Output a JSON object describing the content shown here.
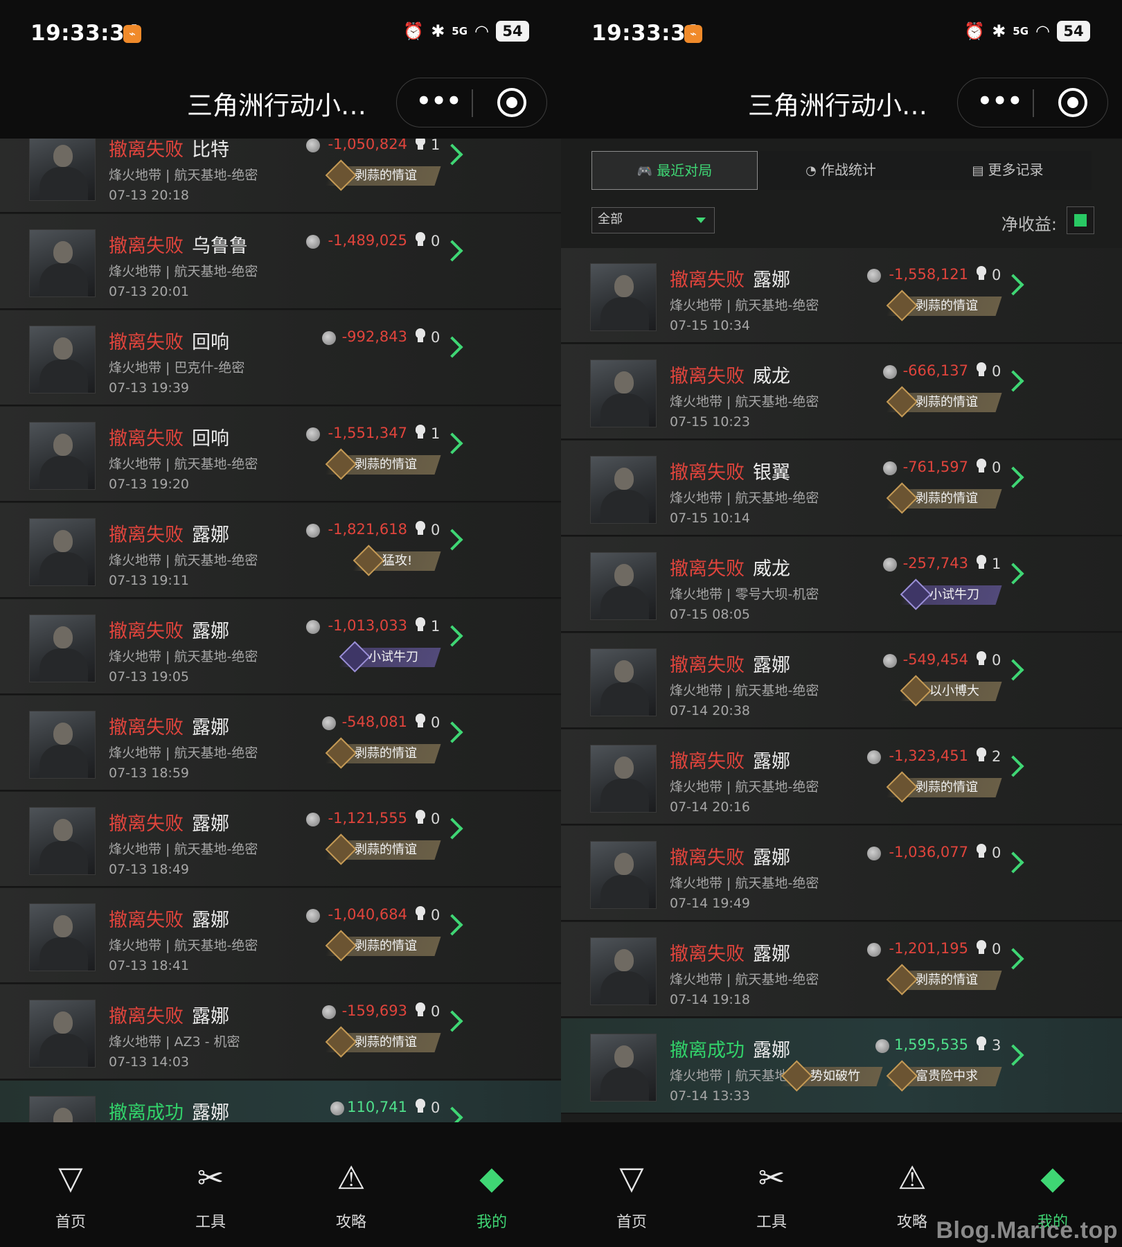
{
  "left": {
    "status_time": "19:33:34",
    "battery": "54",
    "signal": "5G",
    "title": "三角洲行动小…",
    "matches": [
      {
        "result": "撤离失败",
        "operator": "比特",
        "map": "烽火地带 | 航天基地-绝密",
        "time": "07-13 20:18",
        "value": "-1,050,824",
        "kills": "1",
        "badges": [
          {
            "label": "剥蒜的情谊",
            "tone": "gold"
          }
        ]
      },
      {
        "result": "撤离失败",
        "operator": "乌鲁鲁",
        "map": "烽火地带 | 航天基地-绝密",
        "time": "07-13 20:01",
        "value": "-1,489,025",
        "kills": "0",
        "badges": []
      },
      {
        "result": "撤离失败",
        "operator": "回响",
        "map": "烽火地带 | 巴克什-绝密",
        "time": "07-13 19:39",
        "value": "-992,843",
        "kills": "0",
        "badges": []
      },
      {
        "result": "撤离失败",
        "operator": "回响",
        "map": "烽火地带 | 航天基地-绝密",
        "time": "07-13 19:20",
        "value": "-1,551,347",
        "kills": "1",
        "badges": [
          {
            "label": "剥蒜的情谊",
            "tone": "gold"
          }
        ]
      },
      {
        "result": "撤离失败",
        "operator": "露娜",
        "map": "烽火地带 | 航天基地-绝密",
        "time": "07-13 19:11",
        "value": "-1,821,618",
        "kills": "0",
        "badges": [
          {
            "label": "猛攻!",
            "tone": "gold"
          }
        ]
      },
      {
        "result": "撤离失败",
        "operator": "露娜",
        "map": "烽火地带 | 航天基地-绝密",
        "time": "07-13 19:05",
        "value": "-1,013,033",
        "kills": "1",
        "badges": [
          {
            "label": "小试牛刀",
            "tone": "purple"
          }
        ]
      },
      {
        "result": "撤离失败",
        "operator": "露娜",
        "map": "烽火地带 | 航天基地-绝密",
        "time": "07-13 18:59",
        "value": "-548,081",
        "kills": "0",
        "badges": [
          {
            "label": "剥蒜的情谊",
            "tone": "gold"
          }
        ]
      },
      {
        "result": "撤离失败",
        "operator": "露娜",
        "map": "烽火地带 | 航天基地-绝密",
        "time": "07-13 18:49",
        "value": "-1,121,555",
        "kills": "0",
        "badges": [
          {
            "label": "剥蒜的情谊",
            "tone": "gold"
          }
        ]
      },
      {
        "result": "撤离失败",
        "operator": "露娜",
        "map": "烽火地带 | 航天基地-绝密",
        "time": "07-13 18:41",
        "value": "-1,040,684",
        "kills": "0",
        "badges": [
          {
            "label": "剥蒜的情谊",
            "tone": "gold"
          }
        ]
      },
      {
        "result": "撤离失败",
        "operator": "露娜",
        "map": "烽火地带 | AZ3 - 机密",
        "time": "07-13 14:03",
        "value": "-159,693",
        "kills": "0",
        "badges": [
          {
            "label": "剥蒜的情谊",
            "tone": "gold"
          }
        ]
      },
      {
        "result": "撤离成功",
        "operator": "露娜",
        "map": "",
        "time": "",
        "value": "110,741",
        "kills": "0",
        "badges": [],
        "success": true
      }
    ],
    "nav": [
      {
        "label": "首页",
        "icon": "home-icon"
      },
      {
        "label": "工具",
        "icon": "tools-icon"
      },
      {
        "label": "攻略",
        "icon": "guide-icon"
      },
      {
        "label": "我的",
        "icon": "profile-icon",
        "active": true
      }
    ]
  },
  "right": {
    "status_time": "19:33:31",
    "battery": "54",
    "signal": "5G",
    "title": "三角洲行动小…",
    "tabs": [
      {
        "label": "最近对局",
        "icon": "gamepad-icon",
        "active": true
      },
      {
        "label": "作战统计",
        "icon": "pie-chart-icon"
      },
      {
        "label": "更多记录",
        "icon": "document-icon"
      }
    ],
    "filter_value": "全部",
    "net_label": "净收益:",
    "matches": [
      {
        "result": "撤离失败",
        "operator": "露娜",
        "map": "烽火地带 | 航天基地-绝密",
        "time": "07-15 10:34",
        "value": "-1,558,121",
        "kills": "0",
        "badges": [
          {
            "label": "剥蒜的情谊",
            "tone": "gold"
          }
        ]
      },
      {
        "result": "撤离失败",
        "operator": "威龙",
        "map": "烽火地带 | 航天基地-绝密",
        "time": "07-15 10:23",
        "value": "-666,137",
        "kills": "0",
        "badges": [
          {
            "label": "剥蒜的情谊",
            "tone": "gold"
          }
        ]
      },
      {
        "result": "撤离失败",
        "operator": "银翼",
        "map": "烽火地带 | 航天基地-绝密",
        "time": "07-15 10:14",
        "value": "-761,597",
        "kills": "0",
        "badges": [
          {
            "label": "剥蒜的情谊",
            "tone": "gold"
          }
        ]
      },
      {
        "result": "撤离失败",
        "operator": "威龙",
        "map": "烽火地带 | 零号大坝-机密",
        "time": "07-15 08:05",
        "value": "-257,743",
        "kills": "1",
        "badges": [
          {
            "label": "小试牛刀",
            "tone": "purple"
          }
        ]
      },
      {
        "result": "撤离失败",
        "operator": "露娜",
        "map": "烽火地带 | 航天基地-绝密",
        "time": "07-14 20:38",
        "value": "-549,454",
        "kills": "0",
        "badges": [
          {
            "label": "以小博大",
            "tone": "gold"
          }
        ]
      },
      {
        "result": "撤离失败",
        "operator": "露娜",
        "map": "烽火地带 | 航天基地-绝密",
        "time": "07-14 20:16",
        "value": "-1,323,451",
        "kills": "2",
        "badges": [
          {
            "label": "剥蒜的情谊",
            "tone": "gold"
          }
        ]
      },
      {
        "result": "撤离失败",
        "operator": "露娜",
        "map": "烽火地带 | 航天基地-绝密",
        "time": "07-14 19:49",
        "value": "-1,036,077",
        "kills": "0",
        "badges": []
      },
      {
        "result": "撤离失败",
        "operator": "露娜",
        "map": "烽火地带 | 航天基地-绝密",
        "time": "07-14 19:18",
        "value": "-1,201,195",
        "kills": "0",
        "badges": [
          {
            "label": "剥蒜的情谊",
            "tone": "gold"
          }
        ]
      },
      {
        "result": "撤离成功",
        "operator": "露娜",
        "map": "烽火地带 | 航天基地-绝密",
        "time": "07-14 13:33",
        "value": "1,595,535",
        "kills": "3",
        "badges": [
          {
            "label": "势如破竹",
            "tone": "gold"
          },
          {
            "label": "富贵险中求",
            "tone": "gold"
          }
        ],
        "success": true
      }
    ],
    "nav": [
      {
        "label": "首页",
        "icon": "home-icon"
      },
      {
        "label": "工具",
        "icon": "tools-icon"
      },
      {
        "label": "攻略",
        "icon": "guide-icon"
      },
      {
        "label": "我的",
        "icon": "profile-icon",
        "active": true
      }
    ]
  },
  "watermark": "Blog.Marice.top"
}
